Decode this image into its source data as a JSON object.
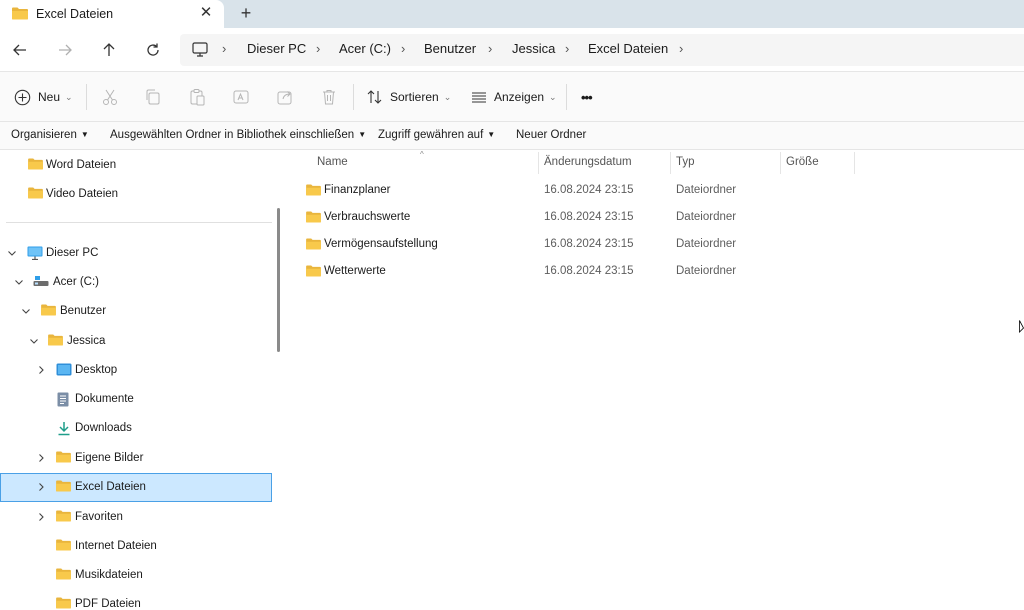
{
  "tab": {
    "title": "Excel Dateien",
    "close": "✕",
    "new": "+"
  },
  "nav": {
    "back": "arrow-left-icon",
    "forward": "arrow-right-icon",
    "up": "arrow-up-icon",
    "refresh": "refresh-icon"
  },
  "breadcrumb": [
    "Dieser PC",
    "Acer (C:)",
    "Benutzer",
    "Jessica",
    "Excel Dateien"
  ],
  "commands": {
    "new_label": "Neu",
    "sort_label": "Sortieren",
    "view_label": "Anzeigen",
    "more_label": "•••"
  },
  "toolbar2": {
    "organize": "Organisieren",
    "library": "Ausgewählten Ordner in Bibliothek einschließen",
    "share": "Zugriff gewähren auf",
    "new_folder": "Neuer Ordner"
  },
  "sidebar": {
    "quick": [
      {
        "label": "Word Dateien"
      },
      {
        "label": "Video Dateien"
      }
    ],
    "tree": [
      {
        "label": "Dieser PC"
      },
      {
        "label": "Acer (C:)"
      },
      {
        "label": "Benutzer"
      },
      {
        "label": "Jessica"
      },
      {
        "label": "Desktop"
      },
      {
        "label": "Dokumente"
      },
      {
        "label": "Downloads"
      },
      {
        "label": "Eigene Bilder"
      },
      {
        "label": "Excel Dateien"
      },
      {
        "label": "Favoriten"
      },
      {
        "label": "Internet Dateien"
      },
      {
        "label": "Musikdateien"
      },
      {
        "label": "PDF Dateien"
      }
    ]
  },
  "columns": {
    "name": "Name",
    "date": "Änderungsdatum",
    "type": "Typ",
    "size": "Größe"
  },
  "files": [
    {
      "name": "Finanzplaner",
      "date": "16.08.2024 23:15",
      "type": "Dateiordner"
    },
    {
      "name": "Verbrauchswerte",
      "date": "16.08.2024 23:15",
      "type": "Dateiordner"
    },
    {
      "name": "Vermögensaufstellung",
      "date": "16.08.2024 23:15",
      "type": "Dateiordner"
    },
    {
      "name": "Wetterwerte",
      "date": "16.08.2024 23:15",
      "type": "Dateiordner"
    }
  ],
  "colors": {
    "accent": "#0067c0",
    "folder": "#f8c94b",
    "selection": "#cce8ff"
  }
}
